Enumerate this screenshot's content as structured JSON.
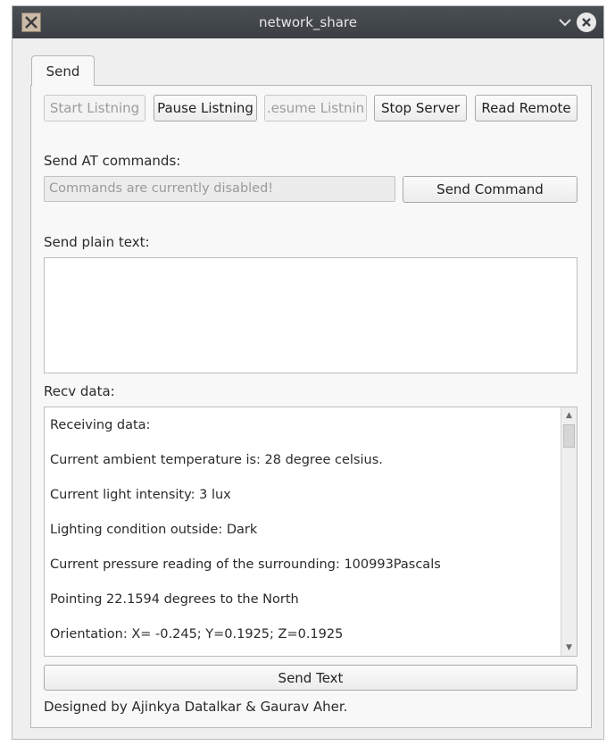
{
  "window": {
    "title": "network_share",
    "icons": {
      "app": "app-x-icon",
      "minimize": "chevron-down-icon",
      "close": "close-circle-icon"
    }
  },
  "tabs": [
    {
      "label": "Send",
      "selected": true
    }
  ],
  "toolbar": {
    "start_label": "Start Listning",
    "pause_label": "Pause Listning",
    "resume_label": ".esume Listnin",
    "stop_label": "Stop Server",
    "read_label": "Read Remote"
  },
  "at_commands": {
    "label": "Send AT commands:",
    "input_placeholder": "Commands are currently disabled!",
    "send_button": "Send Command"
  },
  "plain_text": {
    "label": "Send plain text:",
    "value": ""
  },
  "recv": {
    "label": "Recv data:",
    "lines": [
      "Receiving data:",
      "Current ambient temperature is: 28 degree celsius.",
      "Current light intensity: 3 lux",
      "Lighting condition outside: Dark",
      "Current pressure reading of the surrounding: 100993Pascals",
      "Pointing 22.1594 degrees to the North",
      "Orientation: X= -0.245; Y=0.1925; Z=0.1925"
    ]
  },
  "send_text_button": "Send Text",
  "footer": "Designed by Ajinkya Datalkar & Gaurav Aher.",
  "colors": {
    "titlebar": "#3f4449",
    "window_bg": "#efefef",
    "panel_bg": "#f8f8f8"
  }
}
